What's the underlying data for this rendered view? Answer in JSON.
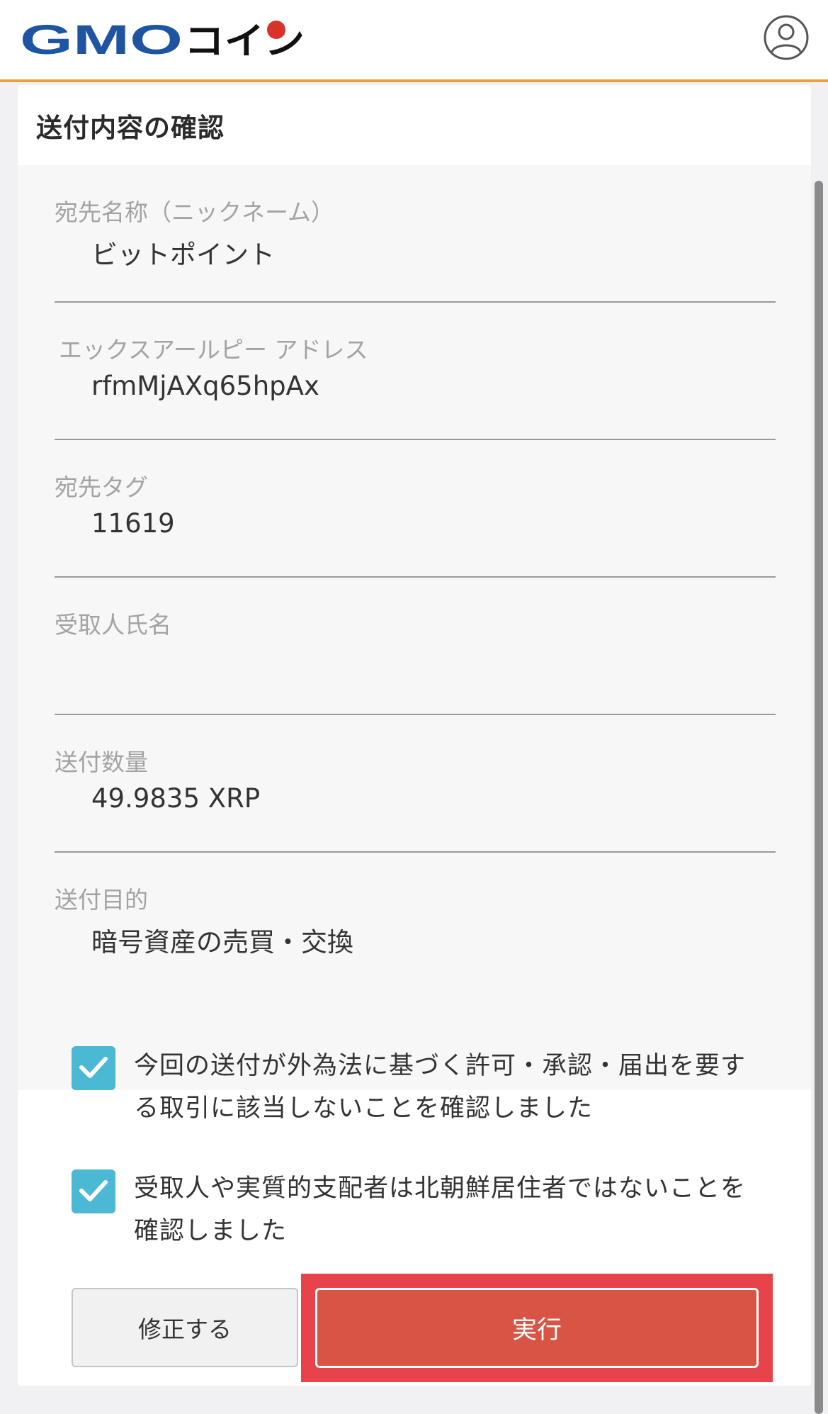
{
  "header": {
    "logo_text": "GMOコイン",
    "logo_icon": "gmo-coin-logo",
    "account_icon": "user-account-icon"
  },
  "card": {
    "title": "送付内容の確認",
    "fields": [
      {
        "label": "宛先名称（ニックネーム）",
        "value": "ビットポイント"
      },
      {
        "label": "エックスアールピー アドレス",
        "value": "rfmMjAXq65hpAx"
      },
      {
        "label": "宛先タグ",
        "value": "11619"
      },
      {
        "label": "受取人氏名",
        "value": ""
      },
      {
        "label": "送付数量",
        "value": "49.9835 XRP"
      },
      {
        "label": "送付目的",
        "value": "暗号資産の売買・交換"
      }
    ],
    "confirmations": [
      {
        "checked": true,
        "text": "今回の送付が外為法に基づく許可・承認・届出を要する取引に該当しないことを確認しました"
      },
      {
        "checked": true,
        "text": "受取人や実質的支配者は北朝鮮居住者ではないことを確認しました"
      }
    ],
    "buttons": {
      "edit_label": "修正する",
      "execute_label": "実行"
    }
  },
  "colors": {
    "header_accent": "#e9a23b",
    "brand_blue": "#1f54a3",
    "brand_red": "#d8322a",
    "checkbox": "#4bb8d4",
    "execute_button": "#d85545",
    "highlight_frame": "#e8424a"
  }
}
